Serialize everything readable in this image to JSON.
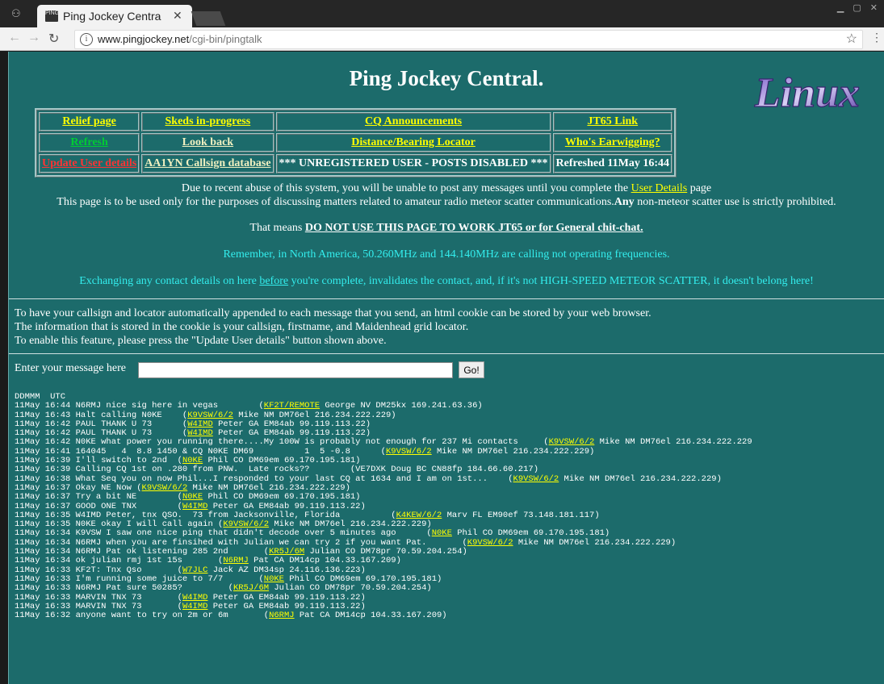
{
  "browser": {
    "tab_title": "Ping Jockey Centra",
    "favicon_text": "PING",
    "url_host": "www.pingjockey.net",
    "url_path": "/cgi-bin/pingtalk"
  },
  "page": {
    "title": "Ping Jockey Central.",
    "logo_text": "Linux",
    "menu": [
      [
        {
          "label": "Relief page",
          "style": "ly"
        },
        {
          "label": "Skeds in-progress",
          "style": "ly"
        },
        {
          "label": "CQ Announcements",
          "style": "ly"
        },
        {
          "label": "JT65 Link",
          "style": "ly"
        }
      ],
      [
        {
          "label": "Refresh",
          "style": "lg"
        },
        {
          "label": "Look back",
          "style": "lw"
        },
        {
          "label": "Distance/Bearing Locator",
          "style": "ly"
        },
        {
          "label": "Who's Earwigging?",
          "style": "ly"
        }
      ],
      [
        {
          "label": "Update User details",
          "style": "lr"
        },
        {
          "label": "AA1YN Callsign database",
          "style": "lw"
        },
        {
          "label": "*** UNREGISTERED USER - POSTS DISABLED ***",
          "style": "wht"
        },
        {
          "label": "Refreshed 11May 16:44",
          "style": "wht"
        }
      ]
    ],
    "notice1_pre": "Due to recent abuse of this system, you will be unable to post any messages until you complete the ",
    "notice1_link": "User Details",
    "notice1_post": " page",
    "notice2_pre": "This page is to be used only for the purposes of discussing matters related to amateur radio meteor scatter communications.",
    "notice2_bold": "Any",
    "notice2_post": " non-meteor scatter use is strictly prohibited.",
    "notice3_pre": "That means ",
    "notice3_bold": "DO NOT USE THIS PAGE TO WORK JT65 or for General chit-chat.",
    "notice4": "Remember, in North America, 50.260MHz and 144.140MHz are calling not operating frequencies.",
    "notice5_pre": "Exchanging any contact details on here ",
    "notice5_link": "before",
    "notice5_post": " you're complete, invalidates the contact, and, if it's not HIGH-SPEED METEOR SCATTER, it doesn't belong here!",
    "cookie_info": [
      "To have your callsign and locator automatically appended to each message that you send, an html cookie can be stored by your web browser.",
      "The information that is stored in the cookie is your callsign, firstname, and Maidenhead grid locator.",
      "To enable this feature, please press the \"Update User details\" button shown above."
    ],
    "message_label": "Enter your message here",
    "message_value": "",
    "go_label": "Go!",
    "log_header": "DDMMM  UTC",
    "log": [
      {
        "pre": "11May 16:44 N6RMJ nice sig here in vegas        (",
        "cs": "KF2T/REMOTE",
        "post": " George NV DM25kx 169.241.63.36)"
      },
      {
        "pre": "11May 16:43 Halt calling N0KE    (",
        "cs": "K9VSW/6/2",
        "post": " Mike NM DM76el 216.234.222.229)"
      },
      {
        "pre": "11May 16:42 PAUL THANK U 73      (",
        "cs": "W4IMD",
        "post": " Peter GA EM84ab 99.119.113.22)"
      },
      {
        "pre": "11May 16:42 PAUL THANK U 73      (",
        "cs": "W4IMD",
        "post": " Peter GA EM84ab 99.119.113.22)"
      },
      {
        "pre": "11May 16:42 N0KE what power you running there....My 100W is probably not enough for 237 Mi contacts     (",
        "cs": "K9VSW/6/2",
        "post": " Mike NM DM76el 216.234.222.229"
      },
      {
        "pre": "11May 16:41 164045   4  8.8 1450 & CQ N0KE DM69          1  5 -0.8      (",
        "cs": "K9VSW/6/2",
        "post": " Mike NM DM76el 216.234.222.229)"
      },
      {
        "pre": "11May 16:39 I'll switch to 2nd  (",
        "cs": "N0KE",
        "post": " Phil CO DM69em 69.170.195.181)"
      },
      {
        "pre": "11May 16:39 Calling CQ 1st on .280 from PNW.  Late rocks??        (VE7DXK Doug BC CN88fp 184.66.60.217)",
        "cs": "",
        "post": ""
      },
      {
        "pre": "11May 16:38 What Seq you on now Phil...I responded to your last CQ at 1634 and I am on 1st...    (",
        "cs": "K9VSW/6/2",
        "post": " Mike NM DM76el 216.234.222.229)"
      },
      {
        "pre": "11May 16:37 Okay NE Now (",
        "cs": "K9VSW/6/2",
        "post": " Mike NM DM76el 216.234.222.229)"
      },
      {
        "pre": "11May 16:37 Try a bit NE        (",
        "cs": "N0KE",
        "post": " Phil CO DM69em 69.170.195.181)"
      },
      {
        "pre": "11May 16:37 GOOD ONE TNX        (",
        "cs": "W4IMD",
        "post": " Peter GA EM84ab 99.119.113.22)"
      },
      {
        "pre": "11May 16:35 W4IMD Peter, tnx QSO.  73 from Jacksonville, Florida          (",
        "cs": "K4KEW/6/2",
        "post": " Marv FL EM90ef 73.148.181.117)"
      },
      {
        "pre": "11May 16:35 N0KE okay I will call again (",
        "cs": "K9VSW/6/2",
        "post": " Mike NM DM76el 216.234.222.229)"
      },
      {
        "pre": "11May 16:34 K9VSW I saw one nice ping that didn't decode over 5 minutes ago      (",
        "cs": "N0KE",
        "post": " Phil CO DM69em 69.170.195.181)"
      },
      {
        "pre": "11May 16:34 N6RMJ when you are finsihed with Julian we can try 2 if you want Pat.       (",
        "cs": "K9VSW/6/2",
        "post": " Mike NM DM76el 216.234.222.229)"
      },
      {
        "pre": "11May 16:34 N6RMJ Pat ok listening 285 2nd       (",
        "cs": "KR5J/6M",
        "post": " Julian CO DM78pr 70.59.204.254)"
      },
      {
        "pre": "11May 16:34 ok julian rmj 1st 15s       (",
        "cs": "N6RMJ",
        "post": " Pat CA DM14cp 104.33.167.209)"
      },
      {
        "pre": "11May 16:33 KF2T: Tnx Qso       (",
        "cs": "W7JLC",
        "post": " Jack AZ DM34sp 24.116.136.223)"
      },
      {
        "pre": "11May 16:33 I'm running some juice to 7/7       (",
        "cs": "N0KE",
        "post": " Phil CO DM69em 69.170.195.181)"
      },
      {
        "pre": "11May 16:33 N6RMJ Pat sure 50285?         (",
        "cs": "KR5J/6M",
        "post": " Julian CO DM78pr 70.59.204.254)"
      },
      {
        "pre": "11May 16:33 MARVIN TNX 73       (",
        "cs": "W4IMD",
        "post": " Peter GA EM84ab 99.119.113.22)"
      },
      {
        "pre": "11May 16:33 MARVIN TNX 73       (",
        "cs": "W4IMD",
        "post": " Peter GA EM84ab 99.119.113.22)"
      },
      {
        "pre": "11May 16:32 anyone want to try on 2m or 6m       (",
        "cs": "N6RMJ",
        "post": " Pat CA DM14cp 104.33.167.209)"
      }
    ]
  }
}
